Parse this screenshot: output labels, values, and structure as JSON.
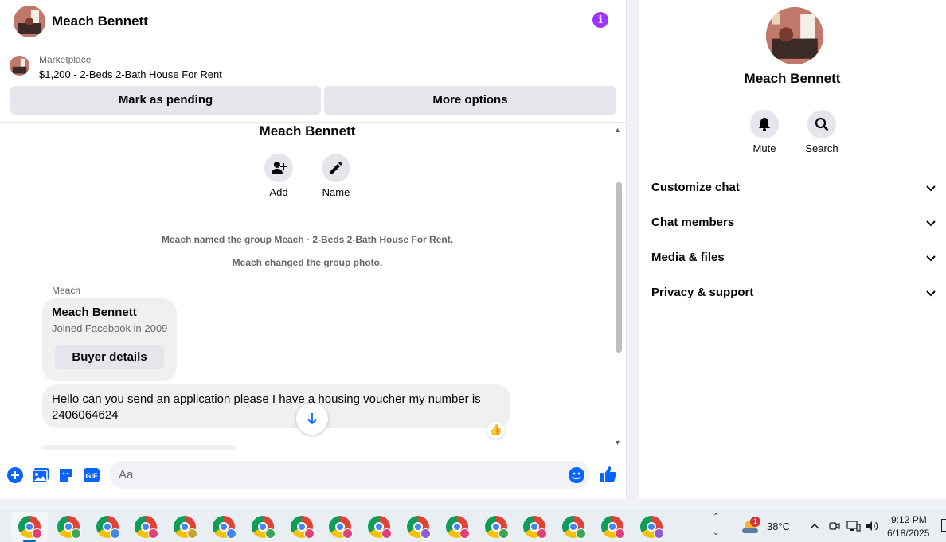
{
  "header": {
    "contact_name": "Meach Bennett",
    "info_icon": "info-icon"
  },
  "listing": {
    "label": "Marketplace",
    "title": "$1,200 - 2-Beds 2-Bath House For Rent"
  },
  "actions": {
    "mark_pending": "Mark as pending",
    "more_options": "More options"
  },
  "thread": {
    "group_name": "Meach Bennett",
    "add_label": "Add",
    "name_label": "Name",
    "system_messages": [
      "Meach named the group Meach · 2-Beds 2-Bath House For Rent.",
      "Meach changed the group photo."
    ],
    "sender_label": "Meach",
    "buyer_card": {
      "name": "Meach Bennett",
      "joined": "Joined Facebook in 2009",
      "button": "Buyer details"
    },
    "message": "Hello can you send an application please I have a housing voucher my number is 2406064624",
    "reaction": "👍"
  },
  "composer": {
    "placeholder": "Aa"
  },
  "details": {
    "name": "Meach Bennett",
    "mute_label": "Mute",
    "search_label": "Search",
    "sections": [
      "Customize chat",
      "Chat members",
      "Media & files",
      "Privacy & support"
    ]
  },
  "taskbar": {
    "weather_temp": "38°C",
    "weather_badge": "1",
    "time": "9:12 PM",
    "date": "6/18/2025"
  },
  "colors": {
    "accent": "#0866ff",
    "info": "#a033ff"
  }
}
